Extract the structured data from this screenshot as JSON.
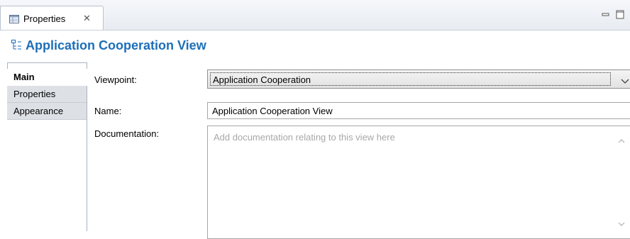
{
  "tab": {
    "label": "Properties",
    "close": "✕",
    "icon": "properties-table-icon"
  },
  "window_controls": {
    "minimize_icon": "minimize-icon",
    "maximize_icon": "maximize-icon"
  },
  "header": {
    "title": "Application Cooperation View",
    "icon": "view-icon",
    "accent_color": "#1d6fb8"
  },
  "sidebar": {
    "tabs": [
      {
        "label": "Main",
        "active": true
      },
      {
        "label": "Properties",
        "active": false
      },
      {
        "label": "Appearance",
        "active": false
      }
    ]
  },
  "form": {
    "viewpoint": {
      "label": "Viewpoint:",
      "value": "Application Cooperation"
    },
    "name": {
      "label": "Name:",
      "value": "Application Cooperation View"
    },
    "documentation": {
      "label": "Documentation:",
      "placeholder": "Add documentation relating to this view here"
    }
  }
}
